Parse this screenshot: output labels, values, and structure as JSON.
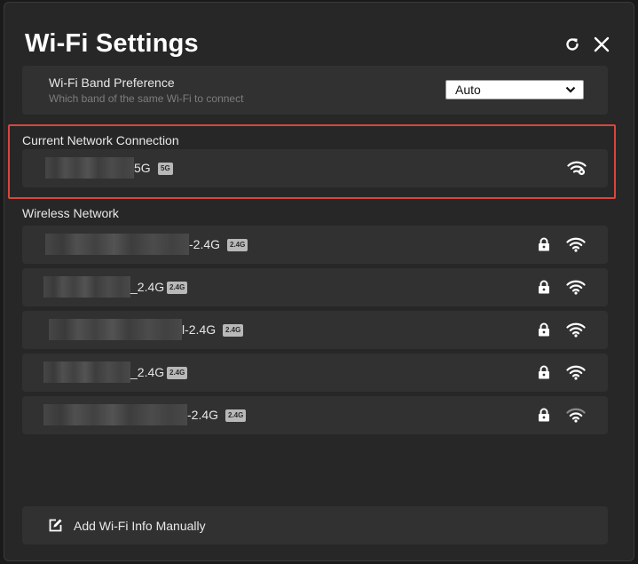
{
  "header": {
    "title": "Wi-Fi Settings",
    "refresh_icon": "refresh-icon",
    "close_icon": "close-icon"
  },
  "band_preference": {
    "title": "Wi-Fi Band Preference",
    "subtitle": "Which band of the same Wi-Fi to connect",
    "selected": "Auto"
  },
  "current": {
    "section_label": "Current Network Connection",
    "network": {
      "name_suffix": "5G",
      "band": "5G",
      "signal_icon": "wifi-connected-icon"
    }
  },
  "wireless": {
    "section_label": "Wireless Network",
    "networks": [
      {
        "name_suffix": "-2.4G",
        "band": "2.4G",
        "secured": true,
        "signal": "full"
      },
      {
        "name_suffix": "_2.4G",
        "band": "2.4G",
        "secured": true,
        "signal": "full"
      },
      {
        "name_suffix": "l-2.4G",
        "band": "2.4G",
        "secured": true,
        "signal": "full"
      },
      {
        "name_suffix": "_2.4G",
        "band": "2.4G",
        "secured": true,
        "signal": "full"
      },
      {
        "name_suffix": "-2.4G",
        "band": "2.4G",
        "secured": true,
        "signal": "medium"
      }
    ]
  },
  "add_manual": {
    "label": "Add Wi-Fi Info Manually",
    "icon": "edit-icon"
  },
  "colors": {
    "background": "#272727",
    "card": "#313131",
    "highlight": "#d9463d"
  }
}
